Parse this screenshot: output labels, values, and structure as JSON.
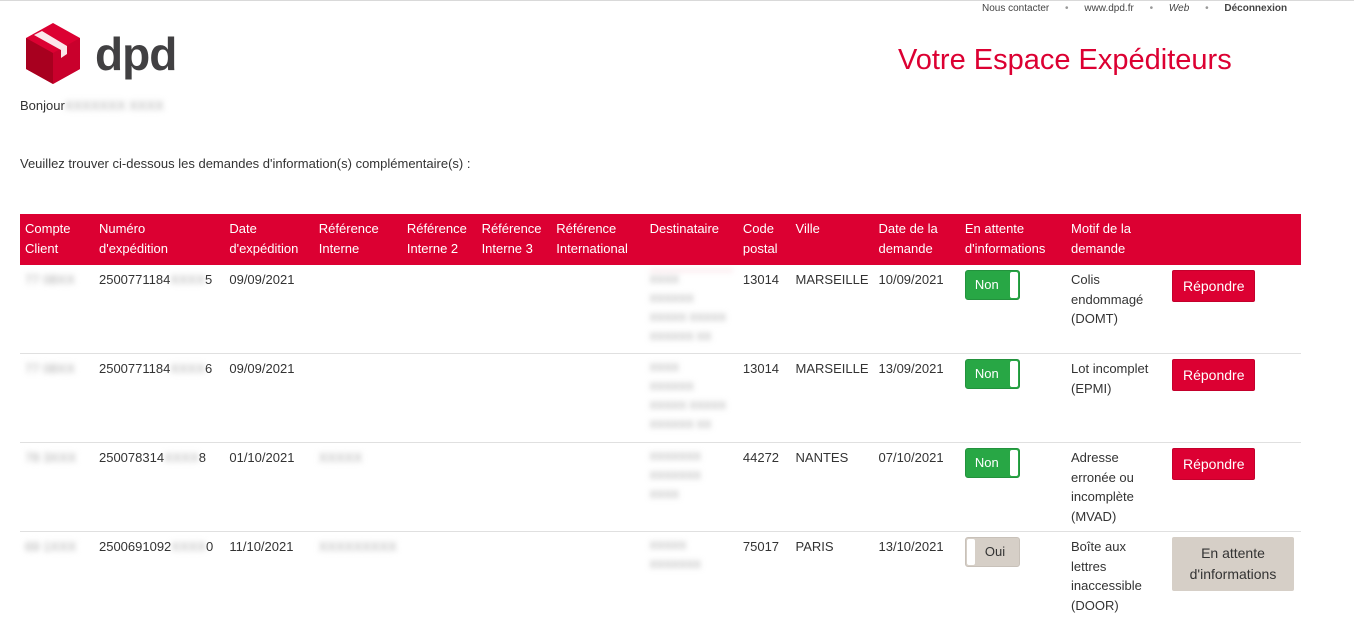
{
  "toplinks": {
    "contact": "Nous contacter",
    "site": "www.dpd.fr",
    "web": "Web",
    "logout": "Déconnexion",
    "sep": "•"
  },
  "logo": {
    "text": "dpd",
    "brand_color": "#dc0032"
  },
  "header": {
    "title": "Votre Espace Expéditeurs"
  },
  "greeting": {
    "label": "Bonjour",
    "name": "XXXXXXX XXXX"
  },
  "intro": "Veuillez trouver ci-dessous les demandes d'information(s) complémentaire(s) :",
  "table": {
    "headers": [
      [
        "Compte",
        "Client"
      ],
      [
        "Numéro",
        "d'expédition"
      ],
      [
        "Date",
        "d'expédition"
      ],
      [
        "Référence",
        "Interne"
      ],
      [
        "Référence",
        "Interne 2"
      ],
      [
        "Référence",
        "Interne 3"
      ],
      [
        "Référence",
        "International"
      ],
      [
        "Destinataire",
        ""
      ],
      [
        "Code",
        "postal"
      ],
      [
        "Ville",
        ""
      ],
      [
        "Date de la",
        "demande"
      ],
      [
        "En attente",
        "d'informations"
      ],
      [
        "Motif de la",
        "demande"
      ],
      [
        "",
        ""
      ]
    ],
    "rows": [
      {
        "compte": "77 08XX",
        "numero_visible": "2500771184",
        "numero_hidden": "XXXX",
        "numero_end": "5",
        "date_exp": "09/09/2021",
        "ref_interne": "",
        "destinataire": [
          "XXXX",
          "XXXXXX",
          "XXXXX XXXXX",
          "XXXXXX XX"
        ],
        "code_postal": "13014",
        "ville": "MARSEILLE",
        "date_demande": "10/09/2021",
        "attente": "Non",
        "motif": [
          "Colis",
          "endommagé",
          "(DOMT)"
        ],
        "action": "Répondre"
      },
      {
        "compte": "77 08XX",
        "numero_visible": "2500771184",
        "numero_hidden": "XXXX",
        "numero_end": "6",
        "date_exp": "09/09/2021",
        "ref_interne": "",
        "destinataire": [
          "XXXX",
          "XXXXXX",
          "XXXXX XXXXX",
          "XXXXXX XX"
        ],
        "code_postal": "13014",
        "ville": "MARSEILLE",
        "date_demande": "13/09/2021",
        "attente": "Non",
        "motif": [
          "Lot incomplet",
          "(EPMI)"
        ],
        "action": "Répondre"
      },
      {
        "compte": "78 3XXX",
        "numero_visible": "250078314",
        "numero_hidden": "XXXX",
        "numero_end": "8",
        "date_exp": "01/10/2021",
        "ref_interne": "XXXXX",
        "destinataire": [
          "XXXXXXX",
          "XXXXXXX",
          "XXXX"
        ],
        "code_postal": "44272",
        "ville": "NANTES",
        "date_demande": "07/10/2021",
        "attente": "Non",
        "motif": [
          "Adresse",
          "erronée ou",
          "incomplète",
          "(MVAD)"
        ],
        "action": "Répondre"
      },
      {
        "compte": "69 1XXX",
        "numero_visible": "2500691092",
        "numero_hidden": "XXXX",
        "numero_end": "0",
        "date_exp": "11/10/2021",
        "ref_interne": "XXXXXXXXX",
        "destinataire": [
          "XXXXX",
          "XXXXXXX"
        ],
        "code_postal": "75017",
        "ville": "PARIS",
        "date_demande": "13/10/2021",
        "attente": "Oui",
        "motif": [
          "Boîte aux",
          "lettres",
          "inaccessible",
          "(DOOR)"
        ],
        "action": "En attente d'informations"
      }
    ]
  }
}
